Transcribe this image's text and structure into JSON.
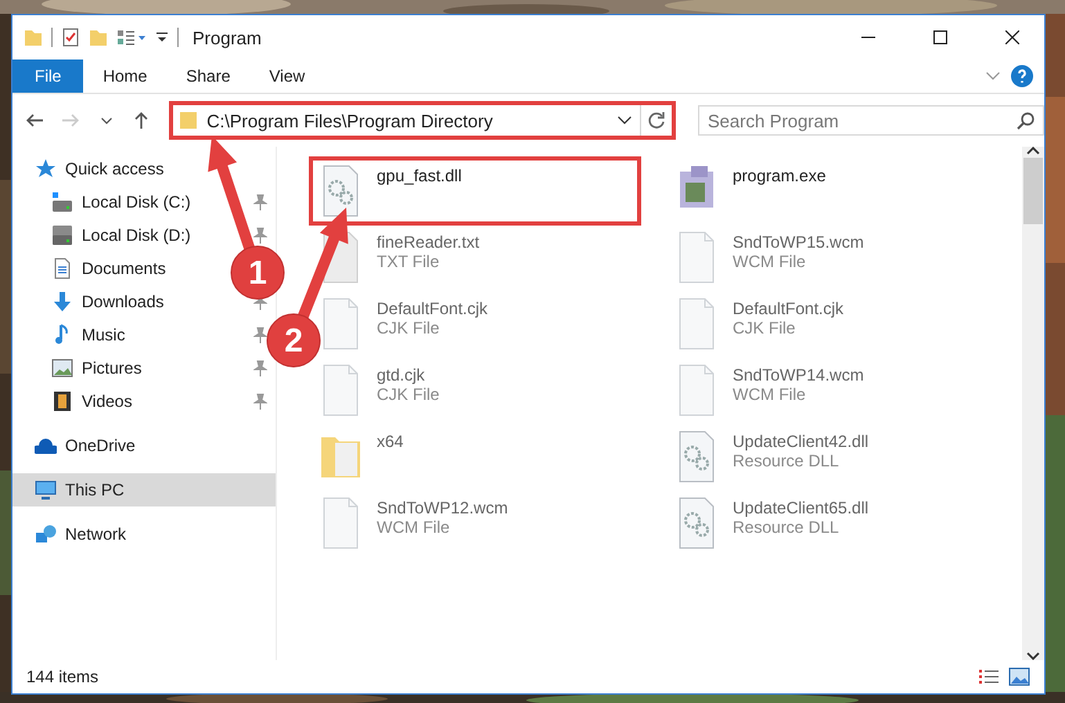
{
  "window": {
    "title": "Program"
  },
  "ribbon_tabs": [
    {
      "label": "File",
      "selected": true
    },
    {
      "label": "Home",
      "selected": false
    },
    {
      "label": "Share",
      "selected": false
    },
    {
      "label": "View",
      "selected": false
    }
  ],
  "address": {
    "path": "C:\\Program Files\\Program Directory",
    "highlighted": true
  },
  "search": {
    "placeholder": "Search Program"
  },
  "sidebar": {
    "items": [
      {
        "label": "Quick access",
        "kind": "star",
        "selected": false,
        "children": [
          {
            "label": "Local Disk (C:)",
            "kind": "drive-c",
            "pinned": true
          },
          {
            "label": "Local Disk (D:)",
            "kind": "drive",
            "pinned": true
          },
          {
            "label": "Documents",
            "kind": "documents"
          },
          {
            "label": "Downloads",
            "kind": "downloads",
            "pinned": true
          },
          {
            "label": "Music",
            "kind": "music",
            "pinned": true
          },
          {
            "label": "Pictures",
            "kind": "pictures",
            "pinned": true
          },
          {
            "label": "Videos",
            "kind": "videos",
            "pinned": true
          }
        ]
      },
      {
        "label": "OneDrive",
        "kind": "cloud",
        "selected": false
      },
      {
        "label": "This PC",
        "kind": "pc",
        "selected": true
      },
      {
        "label": "Network",
        "kind": "network",
        "selected": false
      }
    ]
  },
  "files": [
    {
      "name": "gpu_fast.dll",
      "kind": "dll",
      "highlighted": true
    },
    {
      "name": "program.exe",
      "kind": "exe"
    },
    {
      "name": "fineReader.txt",
      "type": "TXT File",
      "kind": "txt"
    },
    {
      "name": "SndToWP15.wcm",
      "type": "WCM File",
      "kind": "file"
    },
    {
      "name": "DefaultFont.cjk",
      "type": "CJK File",
      "kind": "file"
    },
    {
      "name": "DefaultFont.cjk",
      "type": "CJK File",
      "kind": "file"
    },
    {
      "name": "gtd.cjk",
      "type": "CJK File",
      "kind": "file"
    },
    {
      "name": "SndToWP14.wcm",
      "type": "WCM File",
      "kind": "file"
    },
    {
      "name": "x64",
      "kind": "folder"
    },
    {
      "name": "UpdateClient42.dll",
      "type": "Resource DLL",
      "kind": "dll"
    },
    {
      "name": "SndToWP12.wcm",
      "type": "WCM File",
      "kind": "file"
    },
    {
      "name": "UpdateClient65.dll",
      "type": "Resource DLL",
      "kind": "dll"
    }
  ],
  "status_bar": {
    "count": "144 items"
  },
  "callouts": [
    {
      "number": "1"
    },
    {
      "number": "2"
    }
  ]
}
